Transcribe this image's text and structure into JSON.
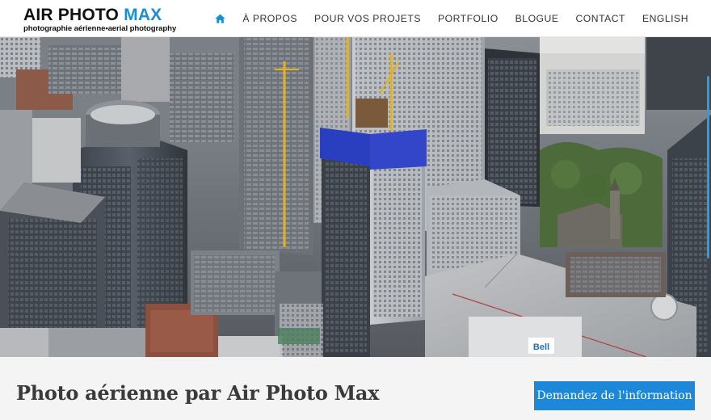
{
  "logo": {
    "name_part1": "AIR PHOTO ",
    "name_part2": "MAX",
    "tagline": "photographie aérienne•aerial photography",
    "accent_color": "#1a8ed8"
  },
  "nav": {
    "home_icon": "home-icon",
    "items": [
      {
        "label": "À PROPOS"
      },
      {
        "label": "POUR VOS PROJETS"
      },
      {
        "label": "PORTFOLIO"
      },
      {
        "label": "BLOGUE"
      },
      {
        "label": "CONTACT"
      },
      {
        "label": "ENGLISH"
      }
    ]
  },
  "hero": {
    "sign_text": "Bell"
  },
  "banner": {
    "title": "Photo aérienne par Air Photo Max",
    "cta_label": "Demandez de l'information",
    "cta_color": "#1e88d8"
  }
}
